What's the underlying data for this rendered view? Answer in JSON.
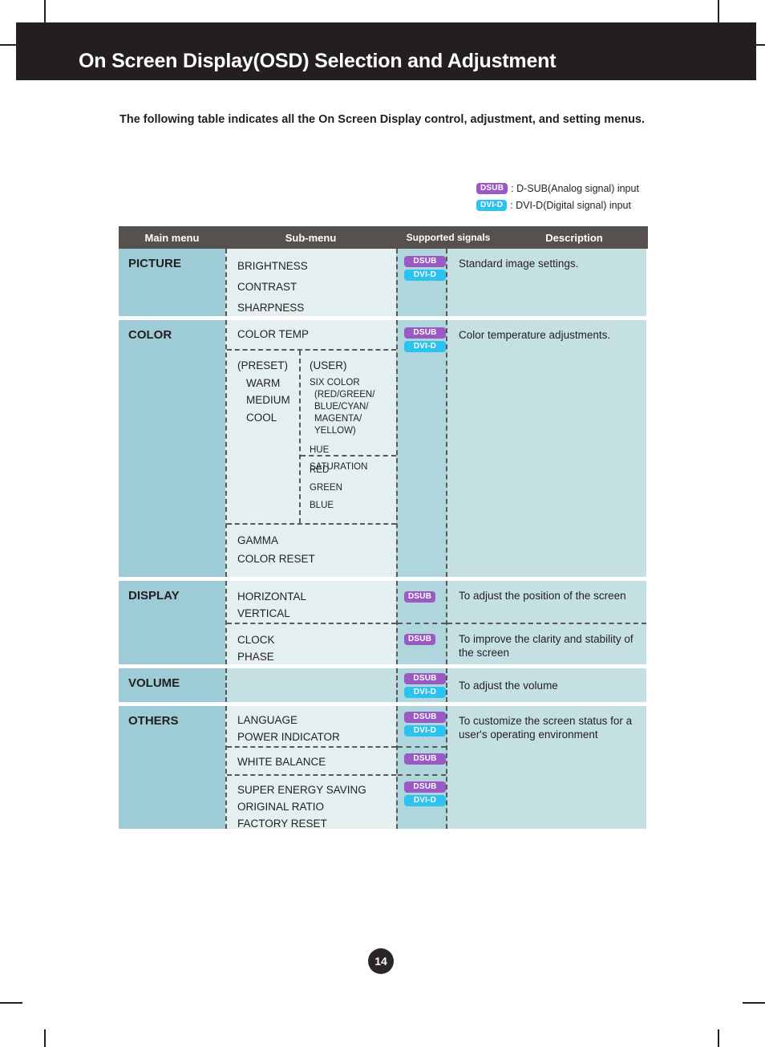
{
  "page": {
    "header_title": "On Screen Display(OSD) Selection and Adjustment",
    "intro": "The following table indicates all the On Screen Display control, adjustment, and setting menus.",
    "page_number": "14"
  },
  "legend": {
    "rows": [
      {
        "badge": "DSUB",
        "badge_kind": "dsub",
        "text": ": D-SUB(Analog signal) input"
      },
      {
        "badge": "DVI-D",
        "badge_kind": "dvid",
        "text": ": DVI-D(Digital signal) input"
      }
    ]
  },
  "colors": {
    "header_band": "#231f20",
    "table_header": "#56504f",
    "main_menu_cell": "#9dccd6",
    "sub_menu_cell": "#e4f0f0",
    "signals_cell": "#afd6dc",
    "description_cell": "#c5e0e3",
    "badge_dsub": "#9b59c4",
    "badge_dvid": "#2ec2f0"
  },
  "table": {
    "headers": {
      "main_menu": "Main menu",
      "sub_menu": "Sub-menu",
      "supported_signals": "Supported signals",
      "description": "Description"
    },
    "picture": {
      "main": "PICTURE",
      "sub": [
        "BRIGHTNESS",
        "CONTRAST",
        "SHARPNESS"
      ],
      "signals": [
        "DSUB",
        "DVI-D"
      ],
      "description": "Standard image settings."
    },
    "color": {
      "main": "COLOR",
      "color_temp_label": "COLOR TEMP",
      "preset_label": "(PRESET)",
      "preset_items": [
        "WARM",
        "MEDIUM",
        "COOL"
      ],
      "user_label": "(USER)",
      "user_six_color": "SIX COLOR",
      "user_six_color_detail": [
        "(RED/GREEN/",
        "BLUE/CYAN/",
        "MAGENTA/",
        "YELLOW)"
      ],
      "user_items_top": [
        "HUE",
        "SATURATION"
      ],
      "user_items_bottom": [
        "RED",
        "GREEN",
        "BLUE"
      ],
      "tail_items": [
        "GAMMA",
        "COLOR RESET"
      ],
      "signals": [
        "DSUB",
        "DVI-D"
      ],
      "description": "Color temperature adjustments."
    },
    "display": {
      "main": "DISPLAY",
      "group1": {
        "sub": [
          "HORIZONTAL",
          "VERTICAL"
        ],
        "signals": [
          "DSUB"
        ],
        "description": "To adjust the position of the screen"
      },
      "group2": {
        "sub": [
          "CLOCK",
          "PHASE"
        ],
        "signals": [
          "DSUB"
        ],
        "description": "To improve the clarity and stability of the screen"
      }
    },
    "volume": {
      "main": "VOLUME",
      "sub": [],
      "signals": [
        "DSUB",
        "DVI-D"
      ],
      "description": "To adjust the volume"
    },
    "others": {
      "main": "OTHERS",
      "group1": {
        "sub": [
          "LANGUAGE",
          "POWER INDICATOR"
        ],
        "signals": [
          "DSUB",
          "DVI-D"
        ]
      },
      "group2": {
        "sub": [
          "WHITE BALANCE"
        ],
        "signals": [
          "DSUB"
        ]
      },
      "group3": {
        "sub": [
          "SUPER ENERGY SAVING",
          "ORIGINAL RATIO",
          "FACTORY RESET"
        ],
        "signals": [
          "DSUB",
          "DVI-D"
        ]
      },
      "description": "To customize the screen status for a user's operating environment"
    }
  }
}
